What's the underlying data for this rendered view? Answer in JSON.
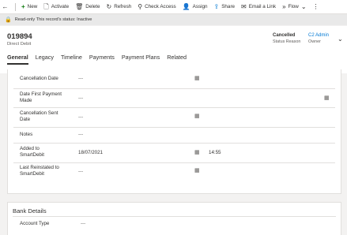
{
  "commands": {
    "back_icon": "back-arrow-icon",
    "new_label": "New",
    "activate_label": "Activate",
    "delete_label": "Delete",
    "refresh_label": "Refresh",
    "check_access_label": "Check Access",
    "assign_label": "Assign",
    "share_label": "Share",
    "email_link_label": "Email a Link",
    "flow_label": "Flow",
    "flow_chevron": "⌄",
    "more_icon": "⋮"
  },
  "banner": {
    "text": "Read-only This record's status: Inactive"
  },
  "header": {
    "title": "019894",
    "subtitle": "Direct Debit",
    "status_value": "Cancelled",
    "status_label": "Status Reason",
    "owner_value": "C2 Admin",
    "owner_label": "Owner"
  },
  "tabs": [
    {
      "label": "General",
      "active": true
    },
    {
      "label": "Legacy"
    },
    {
      "label": "Timeline"
    },
    {
      "label": "Payments"
    },
    {
      "label": "Payment Plans"
    },
    {
      "label": "Related"
    }
  ],
  "fields": {
    "cancellation_date": {
      "label": "Cancellation Date",
      "value": "---"
    },
    "date_first_payment_made": {
      "label": "Date First Payment Made",
      "value": "---"
    },
    "cancellation_sent_date": {
      "label": "Cancellation Sent Date",
      "value": "---"
    },
    "notes": {
      "label": "Notes",
      "value": "---"
    },
    "added_to_smartdebit": {
      "label": "Added to SmartDebit",
      "date": "18/07/2021",
      "time": "14:55"
    },
    "last_reinstated": {
      "label": "Last Reinstated to SmartDebit",
      "value": "---"
    }
  },
  "bank_details": {
    "title": "Bank Details",
    "account_type_label": "Account Type",
    "account_type_value": "---"
  },
  "colors": {
    "accent": "#0078d4",
    "new_icon": "#107c10",
    "banner_bg": "#e9e9e9"
  }
}
